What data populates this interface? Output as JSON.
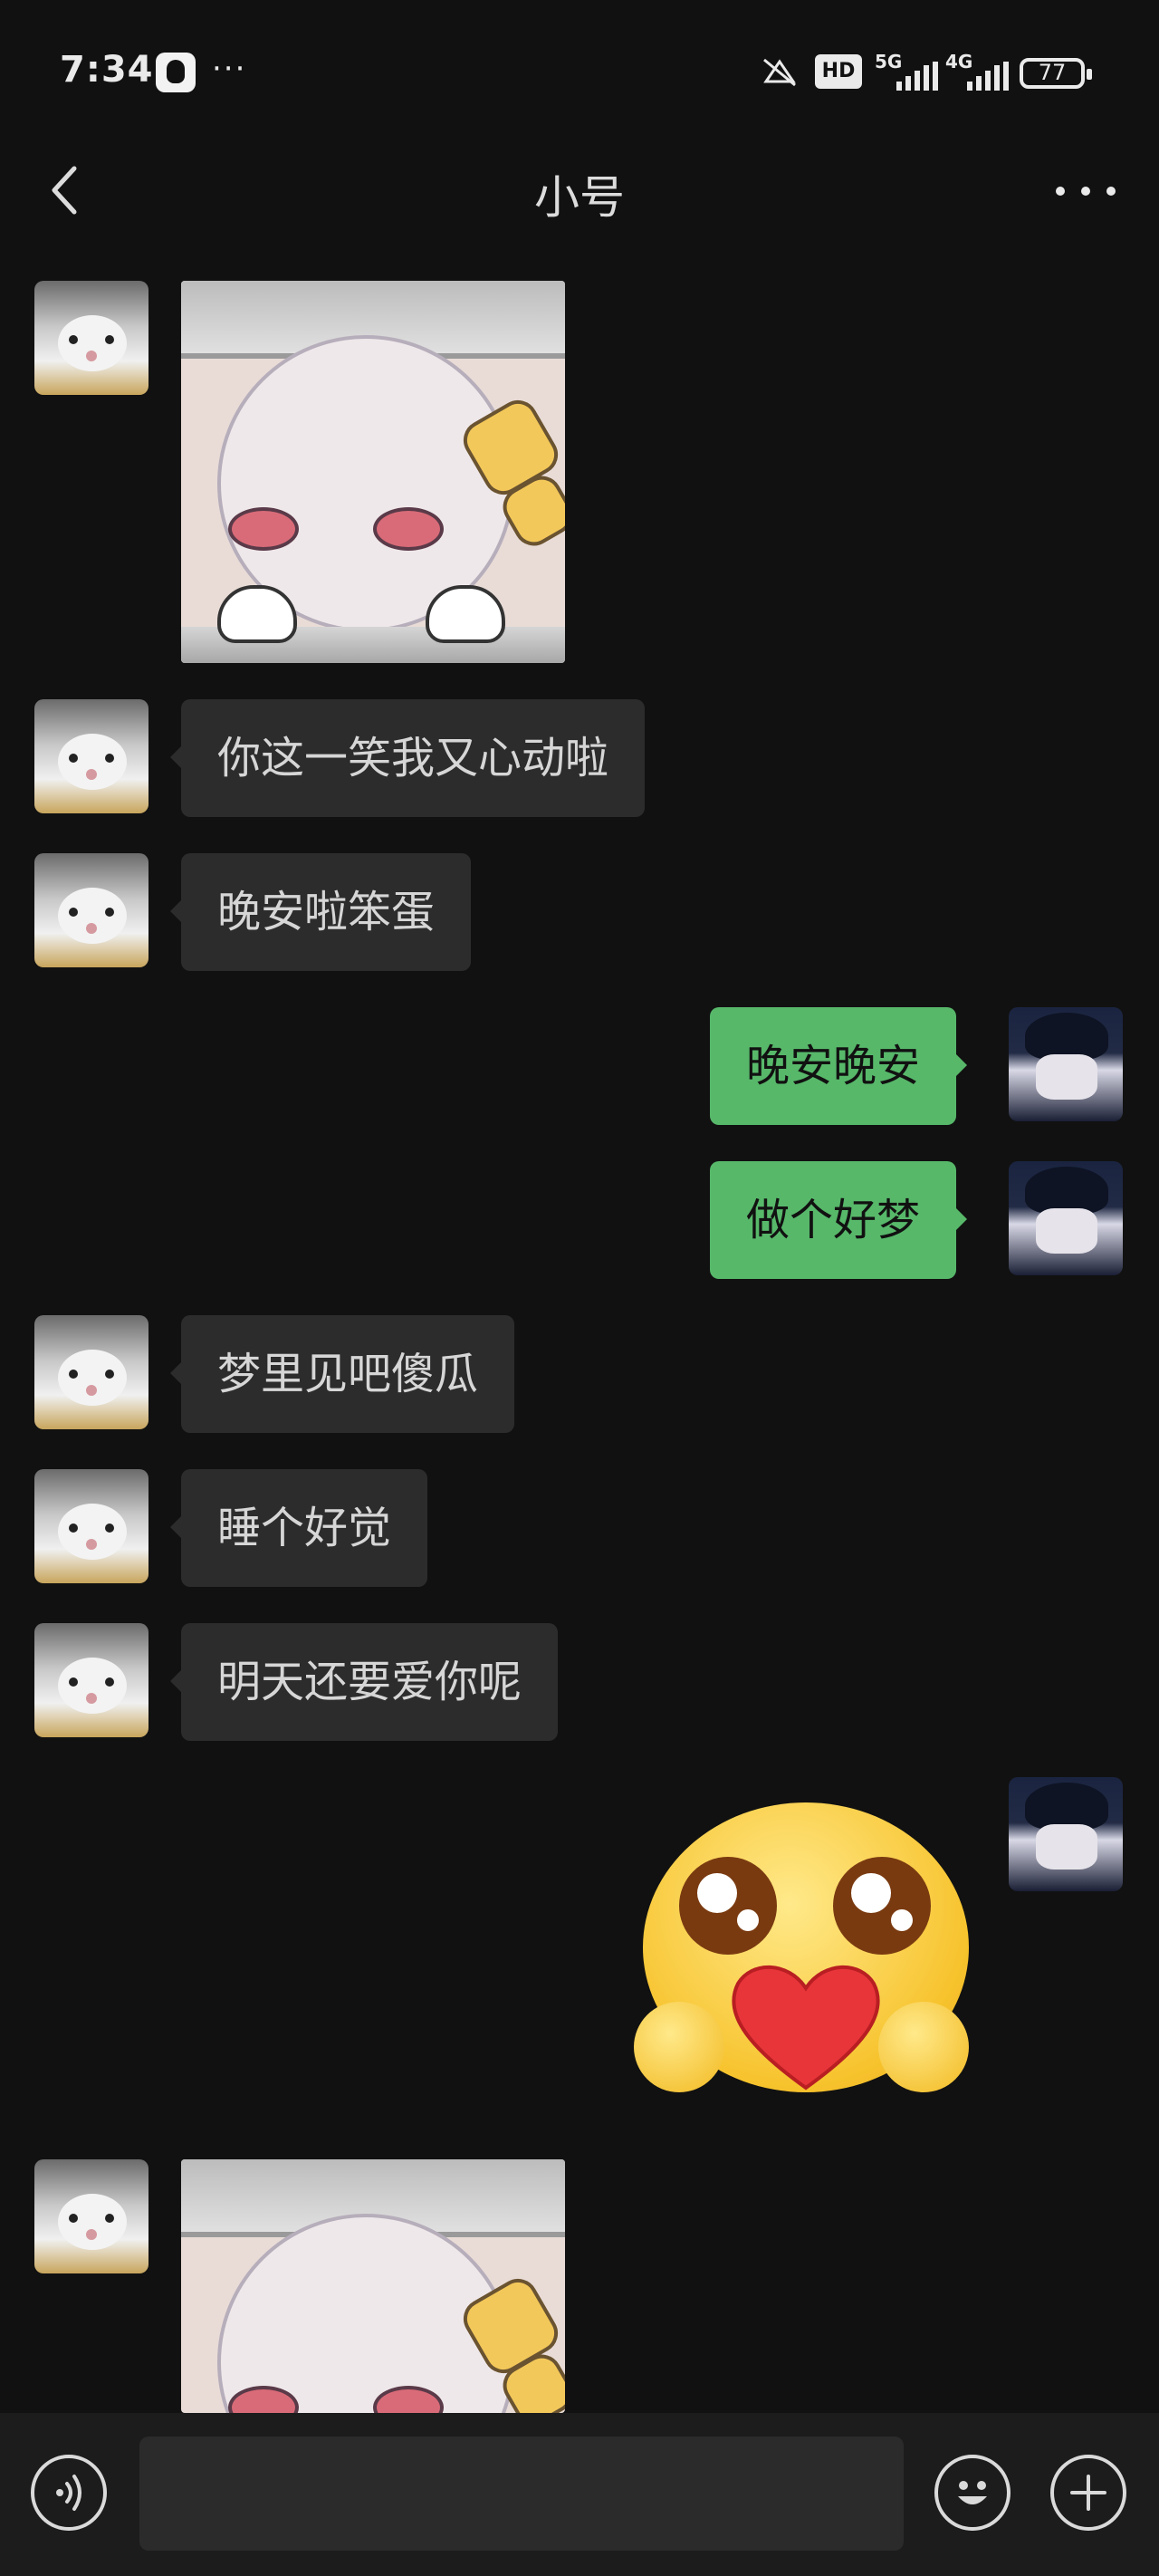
{
  "status_bar": {
    "time": "7:34",
    "battery": "77",
    "network_labels": [
      "HD",
      "5G",
      "4G"
    ]
  },
  "header": {
    "title": "小号"
  },
  "messages": [
    {
      "side": "in",
      "type": "sticker",
      "sticker": "anime-girl-peek"
    },
    {
      "side": "in",
      "type": "text",
      "text": "你这一笑我又心动啦"
    },
    {
      "side": "in",
      "type": "text",
      "text": "晚安啦笨蛋"
    },
    {
      "side": "out",
      "type": "text",
      "text": "晚安晚安"
    },
    {
      "side": "out",
      "type": "text",
      "text": "做个好梦"
    },
    {
      "side": "in",
      "type": "text",
      "text": "梦里见吧傻瓜"
    },
    {
      "side": "in",
      "type": "text",
      "text": "睡个好觉"
    },
    {
      "side": "in",
      "type": "text",
      "text": "明天还要爱你呢"
    },
    {
      "side": "out",
      "type": "sticker",
      "sticker": "heart-hug-emoji"
    },
    {
      "side": "in",
      "type": "sticker",
      "sticker": "anime-girl-peek"
    }
  ],
  "colors": {
    "background": "#111111",
    "incoming_bubble": "#2c2c2c",
    "outgoing_bubble": "#57b86a"
  }
}
